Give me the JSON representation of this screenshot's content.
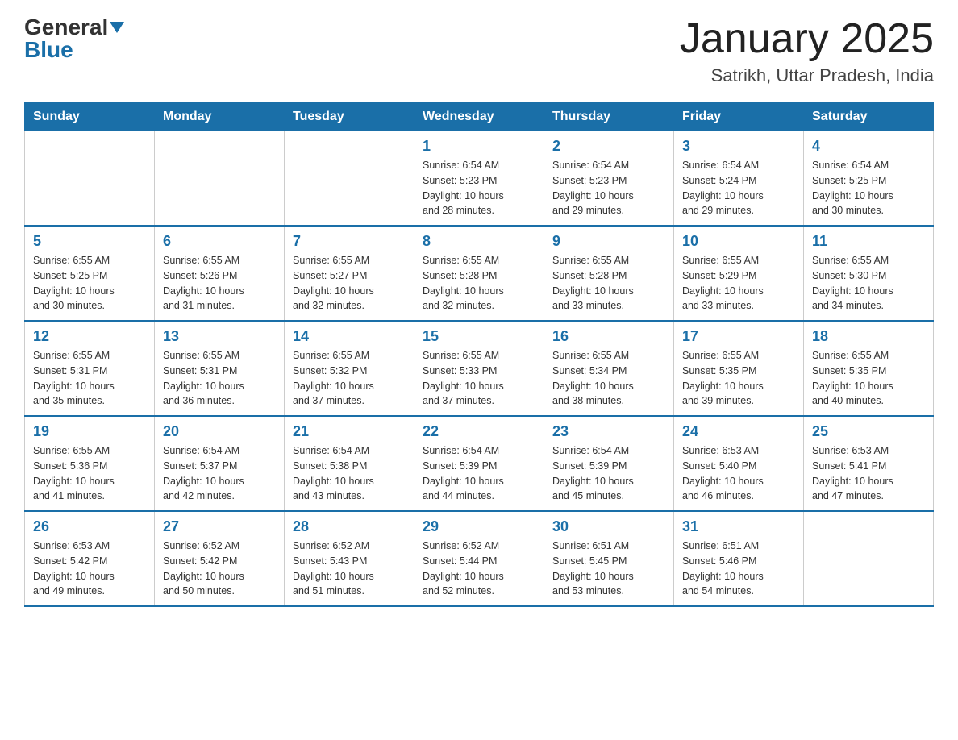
{
  "logo": {
    "general_text": "General",
    "blue_text": "Blue"
  },
  "title": "January 2025",
  "subtitle": "Satrikh, Uttar Pradesh, India",
  "days_of_week": [
    "Sunday",
    "Monday",
    "Tuesday",
    "Wednesday",
    "Thursday",
    "Friday",
    "Saturday"
  ],
  "weeks": [
    [
      {
        "day": "",
        "info": ""
      },
      {
        "day": "",
        "info": ""
      },
      {
        "day": "",
        "info": ""
      },
      {
        "day": "1",
        "info": "Sunrise: 6:54 AM\nSunset: 5:23 PM\nDaylight: 10 hours\nand 28 minutes."
      },
      {
        "day": "2",
        "info": "Sunrise: 6:54 AM\nSunset: 5:23 PM\nDaylight: 10 hours\nand 29 minutes."
      },
      {
        "day": "3",
        "info": "Sunrise: 6:54 AM\nSunset: 5:24 PM\nDaylight: 10 hours\nand 29 minutes."
      },
      {
        "day": "4",
        "info": "Sunrise: 6:54 AM\nSunset: 5:25 PM\nDaylight: 10 hours\nand 30 minutes."
      }
    ],
    [
      {
        "day": "5",
        "info": "Sunrise: 6:55 AM\nSunset: 5:25 PM\nDaylight: 10 hours\nand 30 minutes."
      },
      {
        "day": "6",
        "info": "Sunrise: 6:55 AM\nSunset: 5:26 PM\nDaylight: 10 hours\nand 31 minutes."
      },
      {
        "day": "7",
        "info": "Sunrise: 6:55 AM\nSunset: 5:27 PM\nDaylight: 10 hours\nand 32 minutes."
      },
      {
        "day": "8",
        "info": "Sunrise: 6:55 AM\nSunset: 5:28 PM\nDaylight: 10 hours\nand 32 minutes."
      },
      {
        "day": "9",
        "info": "Sunrise: 6:55 AM\nSunset: 5:28 PM\nDaylight: 10 hours\nand 33 minutes."
      },
      {
        "day": "10",
        "info": "Sunrise: 6:55 AM\nSunset: 5:29 PM\nDaylight: 10 hours\nand 33 minutes."
      },
      {
        "day": "11",
        "info": "Sunrise: 6:55 AM\nSunset: 5:30 PM\nDaylight: 10 hours\nand 34 minutes."
      }
    ],
    [
      {
        "day": "12",
        "info": "Sunrise: 6:55 AM\nSunset: 5:31 PM\nDaylight: 10 hours\nand 35 minutes."
      },
      {
        "day": "13",
        "info": "Sunrise: 6:55 AM\nSunset: 5:31 PM\nDaylight: 10 hours\nand 36 minutes."
      },
      {
        "day": "14",
        "info": "Sunrise: 6:55 AM\nSunset: 5:32 PM\nDaylight: 10 hours\nand 37 minutes."
      },
      {
        "day": "15",
        "info": "Sunrise: 6:55 AM\nSunset: 5:33 PM\nDaylight: 10 hours\nand 37 minutes."
      },
      {
        "day": "16",
        "info": "Sunrise: 6:55 AM\nSunset: 5:34 PM\nDaylight: 10 hours\nand 38 minutes."
      },
      {
        "day": "17",
        "info": "Sunrise: 6:55 AM\nSunset: 5:35 PM\nDaylight: 10 hours\nand 39 minutes."
      },
      {
        "day": "18",
        "info": "Sunrise: 6:55 AM\nSunset: 5:35 PM\nDaylight: 10 hours\nand 40 minutes."
      }
    ],
    [
      {
        "day": "19",
        "info": "Sunrise: 6:55 AM\nSunset: 5:36 PM\nDaylight: 10 hours\nand 41 minutes."
      },
      {
        "day": "20",
        "info": "Sunrise: 6:54 AM\nSunset: 5:37 PM\nDaylight: 10 hours\nand 42 minutes."
      },
      {
        "day": "21",
        "info": "Sunrise: 6:54 AM\nSunset: 5:38 PM\nDaylight: 10 hours\nand 43 minutes."
      },
      {
        "day": "22",
        "info": "Sunrise: 6:54 AM\nSunset: 5:39 PM\nDaylight: 10 hours\nand 44 minutes."
      },
      {
        "day": "23",
        "info": "Sunrise: 6:54 AM\nSunset: 5:39 PM\nDaylight: 10 hours\nand 45 minutes."
      },
      {
        "day": "24",
        "info": "Sunrise: 6:53 AM\nSunset: 5:40 PM\nDaylight: 10 hours\nand 46 minutes."
      },
      {
        "day": "25",
        "info": "Sunrise: 6:53 AM\nSunset: 5:41 PM\nDaylight: 10 hours\nand 47 minutes."
      }
    ],
    [
      {
        "day": "26",
        "info": "Sunrise: 6:53 AM\nSunset: 5:42 PM\nDaylight: 10 hours\nand 49 minutes."
      },
      {
        "day": "27",
        "info": "Sunrise: 6:52 AM\nSunset: 5:42 PM\nDaylight: 10 hours\nand 50 minutes."
      },
      {
        "day": "28",
        "info": "Sunrise: 6:52 AM\nSunset: 5:43 PM\nDaylight: 10 hours\nand 51 minutes."
      },
      {
        "day": "29",
        "info": "Sunrise: 6:52 AM\nSunset: 5:44 PM\nDaylight: 10 hours\nand 52 minutes."
      },
      {
        "day": "30",
        "info": "Sunrise: 6:51 AM\nSunset: 5:45 PM\nDaylight: 10 hours\nand 53 minutes."
      },
      {
        "day": "31",
        "info": "Sunrise: 6:51 AM\nSunset: 5:46 PM\nDaylight: 10 hours\nand 54 minutes."
      },
      {
        "day": "",
        "info": ""
      }
    ]
  ]
}
